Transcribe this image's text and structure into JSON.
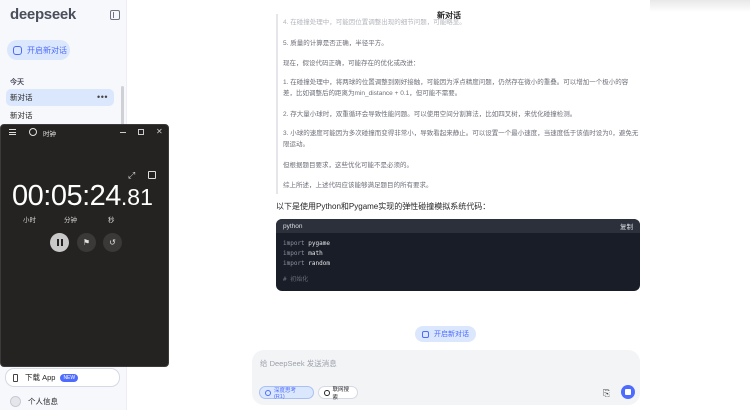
{
  "sidebar": {
    "logo": "deepseek",
    "new_chat_label": "开启新对话",
    "section_today": "今天",
    "items": [
      {
        "label": "新对话",
        "more": "•••"
      },
      {
        "label": "新对话"
      }
    ],
    "download_app": "下载 App",
    "new_badge": "NEW",
    "profile": "个人信息"
  },
  "main": {
    "title": "新对话",
    "faded_top": "4. 在碰撞处理中，可能因位置调整出现的细节问题，可能略显。",
    "paragraphs": [
      "5. 质量的计算是否正确，半径平方。",
      "现在，假设代码正确，可能存在的优化或改进：",
      "1. 在碰撞处理中，将两球的位置调整到刚好接触，可能因为浮点精度问题，仍然存在微小的重叠。可以增加一个极小的容差，比如调整后的距离为min_distance + 0.1，但可能不需要。",
      "2. 存大量小球时，双重循环会导致性能问题。可以使用空间分割算法，比如四叉树，来优化碰撞检测。",
      "3. 小球的速度可能因为多次碰撞而变得非常小，导致看起来静止。可以设置一个最小速度，当速度低于该值时设为0，避免无限运动。",
      "但根据题目要求，这些优化可能不是必须的。",
      "综上所述，上述代码应该能够满足题目的所有要求。"
    ],
    "intro": "以下是使用Python和Pygame实现的弹性碰撞模拟系统代码：",
    "code": {
      "language": "python",
      "copy_label": "复制",
      "lines": [
        {
          "kw": "import",
          "rest": " pygame"
        },
        {
          "kw": "import",
          "rest": " math"
        },
        {
          "kw": "import",
          "rest": " random"
        }
      ],
      "comment": "# 初始化"
    },
    "new_chat_center": "开启新对话",
    "input": {
      "placeholder": "给 DeepSeek 发送消息",
      "deepthink": "深度思考 (R1)",
      "search": "联网搜索"
    }
  },
  "timer_window": {
    "title": "时钟",
    "time_main": "00:05:24",
    "time_frac": ".81",
    "unit_hours": "小时",
    "unit_minutes": "分钟",
    "unit_seconds": "秒"
  },
  "colors": {
    "accent": "#4d6bfe",
    "accent_light": "#dbe7fc",
    "timer_bg": "#242321",
    "code_bg": "#181d27"
  }
}
